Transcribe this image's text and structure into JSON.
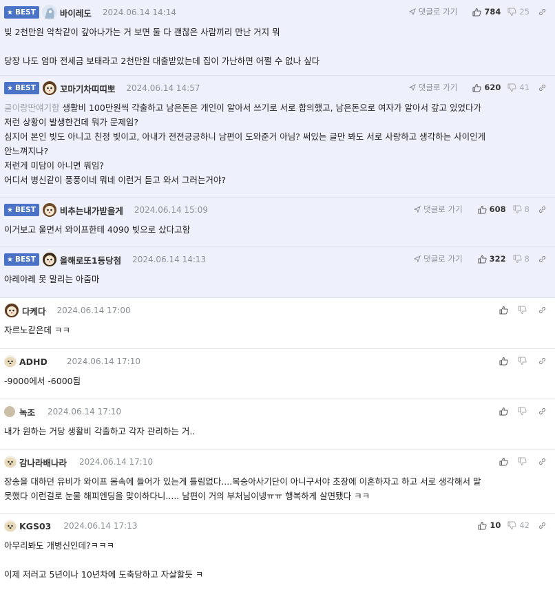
{
  "reply_label": "댓글로 가기",
  "comments": [
    {
      "best": true,
      "badge": "BEST",
      "nick": "바이레도",
      "date": "2024.06.14 14:14",
      "up": "784",
      "down": "25",
      "quote": "",
      "text": "빚 2천만원 악착같이 갚아나가는 거 보면 둘 다 괜찮은 사람끼리 만난 거지 뭐\n\n당장 나도 엄마 전세금 보태라고 2천만원 대출받았는데 집이 가난하면 어쩔 수 없나 싶다"
    },
    {
      "best": true,
      "badge": "BEST",
      "nick": "꼬마기차띠띠뽀",
      "date": "2024.06.14 14:57",
      "up": "620",
      "down": "41",
      "quote": "글이랑딴얘기함",
      "text": " 생활비 100만원씩 갹출하고 남은돈은 개인이 알아서 쓰기로 서로 합의했고, 남은돈으로 여자가 알아서 갚고 있었다가\n저런 상황이 발생한건데 뭐가 문제임?\n심지어 본인 빚도 아니고 친정 빚이고, 아내가 전전긍긍하니 남편이 도와준거 아님? 써있는 글만 봐도 서로 사랑하고 생각하는 사이인게\n안느껴지나?\n저런게 미담이 아니면 뭐임?\n어디서 병신같이 풍풍이네 뭐네 이런거 듣고 와서 그러는거야?"
    },
    {
      "best": true,
      "badge": "BEST",
      "nick": "비추는내가받을게",
      "date": "2024.06.14 15:09",
      "up": "608",
      "down": "8",
      "quote": "",
      "text": "이거보고 울면서 와이프한테 4090 빚으로 샀다고함"
    },
    {
      "best": true,
      "badge": "BEST",
      "nick": "올해로또1등당첨",
      "date": "2024.06.14 14:13",
      "up": "322",
      "down": "8",
      "quote": "",
      "text": "야레야레 못 말리는 아줌마"
    },
    {
      "best": false,
      "nick": "다케다",
      "date": "2024.06.14 17:00",
      "up": "",
      "down": "",
      "quote": "",
      "text": "자르노같은데 ㅋㅋ"
    },
    {
      "best": false,
      "nick": "ADHD",
      "date": "2024.06.14 17:10",
      "up": "",
      "down": "",
      "quote": "",
      "text": "-9000에서 -6000됨"
    },
    {
      "best": false,
      "nick": "녹조",
      "date": "2024.06.14 17:10",
      "up": "",
      "down": "",
      "quote": "",
      "text": "내가 원하는 거당 생활비 각출하고 각자 관리하는 거.."
    },
    {
      "best": false,
      "nick": "감나라배나라",
      "date": "2024.06.14 17:10",
      "up": "",
      "down": "",
      "quote": "",
      "text": "장송을 대하던 유비가 와이프 몸속에 들어가 있는게 틀림없다....복숭아사기단이 아니구서야 초장에 이혼하자고 하고 서로 생각해서 말\n못했다 이런걸로 눈물 해피엔딩을 맞이하다니..... 남편이 거의 부처님이넹ㅠㅠ 행복하게 살면됐다 ㅋㅋ"
    },
    {
      "best": false,
      "nick": "KGS03",
      "date": "2024.06.14 17:13",
      "up": "10",
      "down": "42",
      "quote": "",
      "text": "아무리봐도 개병신인데?ㅋㅋㅋ\n\n이제 저러고 5년이나 10년차에 도축당하고 자살할듯 ㅋ"
    }
  ]
}
